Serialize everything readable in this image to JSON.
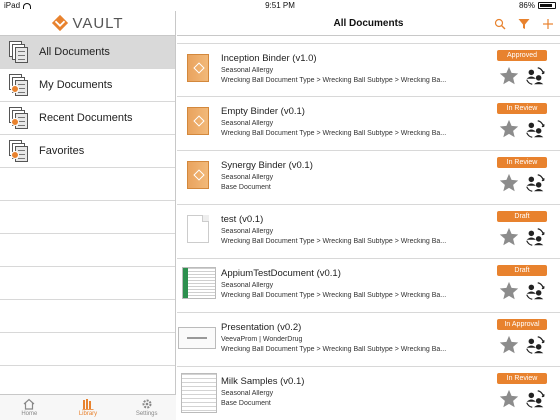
{
  "status_bar": {
    "device": "iPad",
    "time": "9:51 PM",
    "battery": "86%",
    "battery_level": 0.86
  },
  "brand": {
    "logo_text": "VAULT",
    "accent": "#e8822e"
  },
  "sidebar": {
    "items": [
      {
        "label": "All Documents",
        "icon": "documents-icon",
        "active": true
      },
      {
        "label": "My Documents",
        "icon": "my-documents-icon",
        "active": false
      },
      {
        "label": "Recent Documents",
        "icon": "recent-documents-icon",
        "active": false
      },
      {
        "label": "Favorites",
        "icon": "favorites-icon",
        "active": false
      }
    ],
    "tabs": [
      {
        "label": "Home",
        "icon": "home-icon",
        "active": false
      },
      {
        "label": "Library",
        "icon": "library-icon",
        "active": true
      },
      {
        "label": "Settings",
        "icon": "gear-icon",
        "active": false
      }
    ]
  },
  "main": {
    "title": "All Documents",
    "actions": [
      "search-icon",
      "filter-icon",
      "add-icon"
    ],
    "documents": [
      {
        "title": "Inception Binder (v1.0)",
        "line1": "Seasonal Allergy",
        "line2": "Wrecking Ball Document Type > Wrecking Ball Subtype > Wrecking Ba...",
        "status": "Approved",
        "thumb": "binder"
      },
      {
        "title": "Empty Binder (v0.1)",
        "line1": "Seasonal Allergy",
        "line2": "Wrecking Ball Document Type > Wrecking Ball Subtype > Wrecking Ba...",
        "status": "In Review",
        "thumb": "binder"
      },
      {
        "title": "Synergy Binder (v0.1)",
        "line1": "Seasonal Allergy",
        "line2": "Base Document",
        "status": "In Review",
        "thumb": "binder"
      },
      {
        "title": "test (v0.1)",
        "line1": "Seasonal Allergy",
        "line2": "Wrecking Ball Document Type > Wrecking Ball Subtype > Wrecking Ba...",
        "status": "Draft",
        "thumb": "blank"
      },
      {
        "title": "AppiumTestDocument (v0.1)",
        "line1": "Seasonal Allergy",
        "line2": "Wrecking Ball Document Type > Wrecking Ball Subtype > Wrecking Ba...",
        "status": "Draft",
        "thumb": "sheet"
      },
      {
        "title": "Presentation (v0.2)",
        "line1": "VeevaProm | WonderDrug",
        "line2": "Wrecking Ball Document Type > Wrecking Ball Subtype > Wrecking Ba...",
        "status": "In Approval",
        "thumb": "slide"
      },
      {
        "title": "Milk Samples (v0.1)",
        "line1": "Seasonal Allergy",
        "line2": "Base Document",
        "status": "In Review",
        "thumb": "form"
      }
    ]
  }
}
